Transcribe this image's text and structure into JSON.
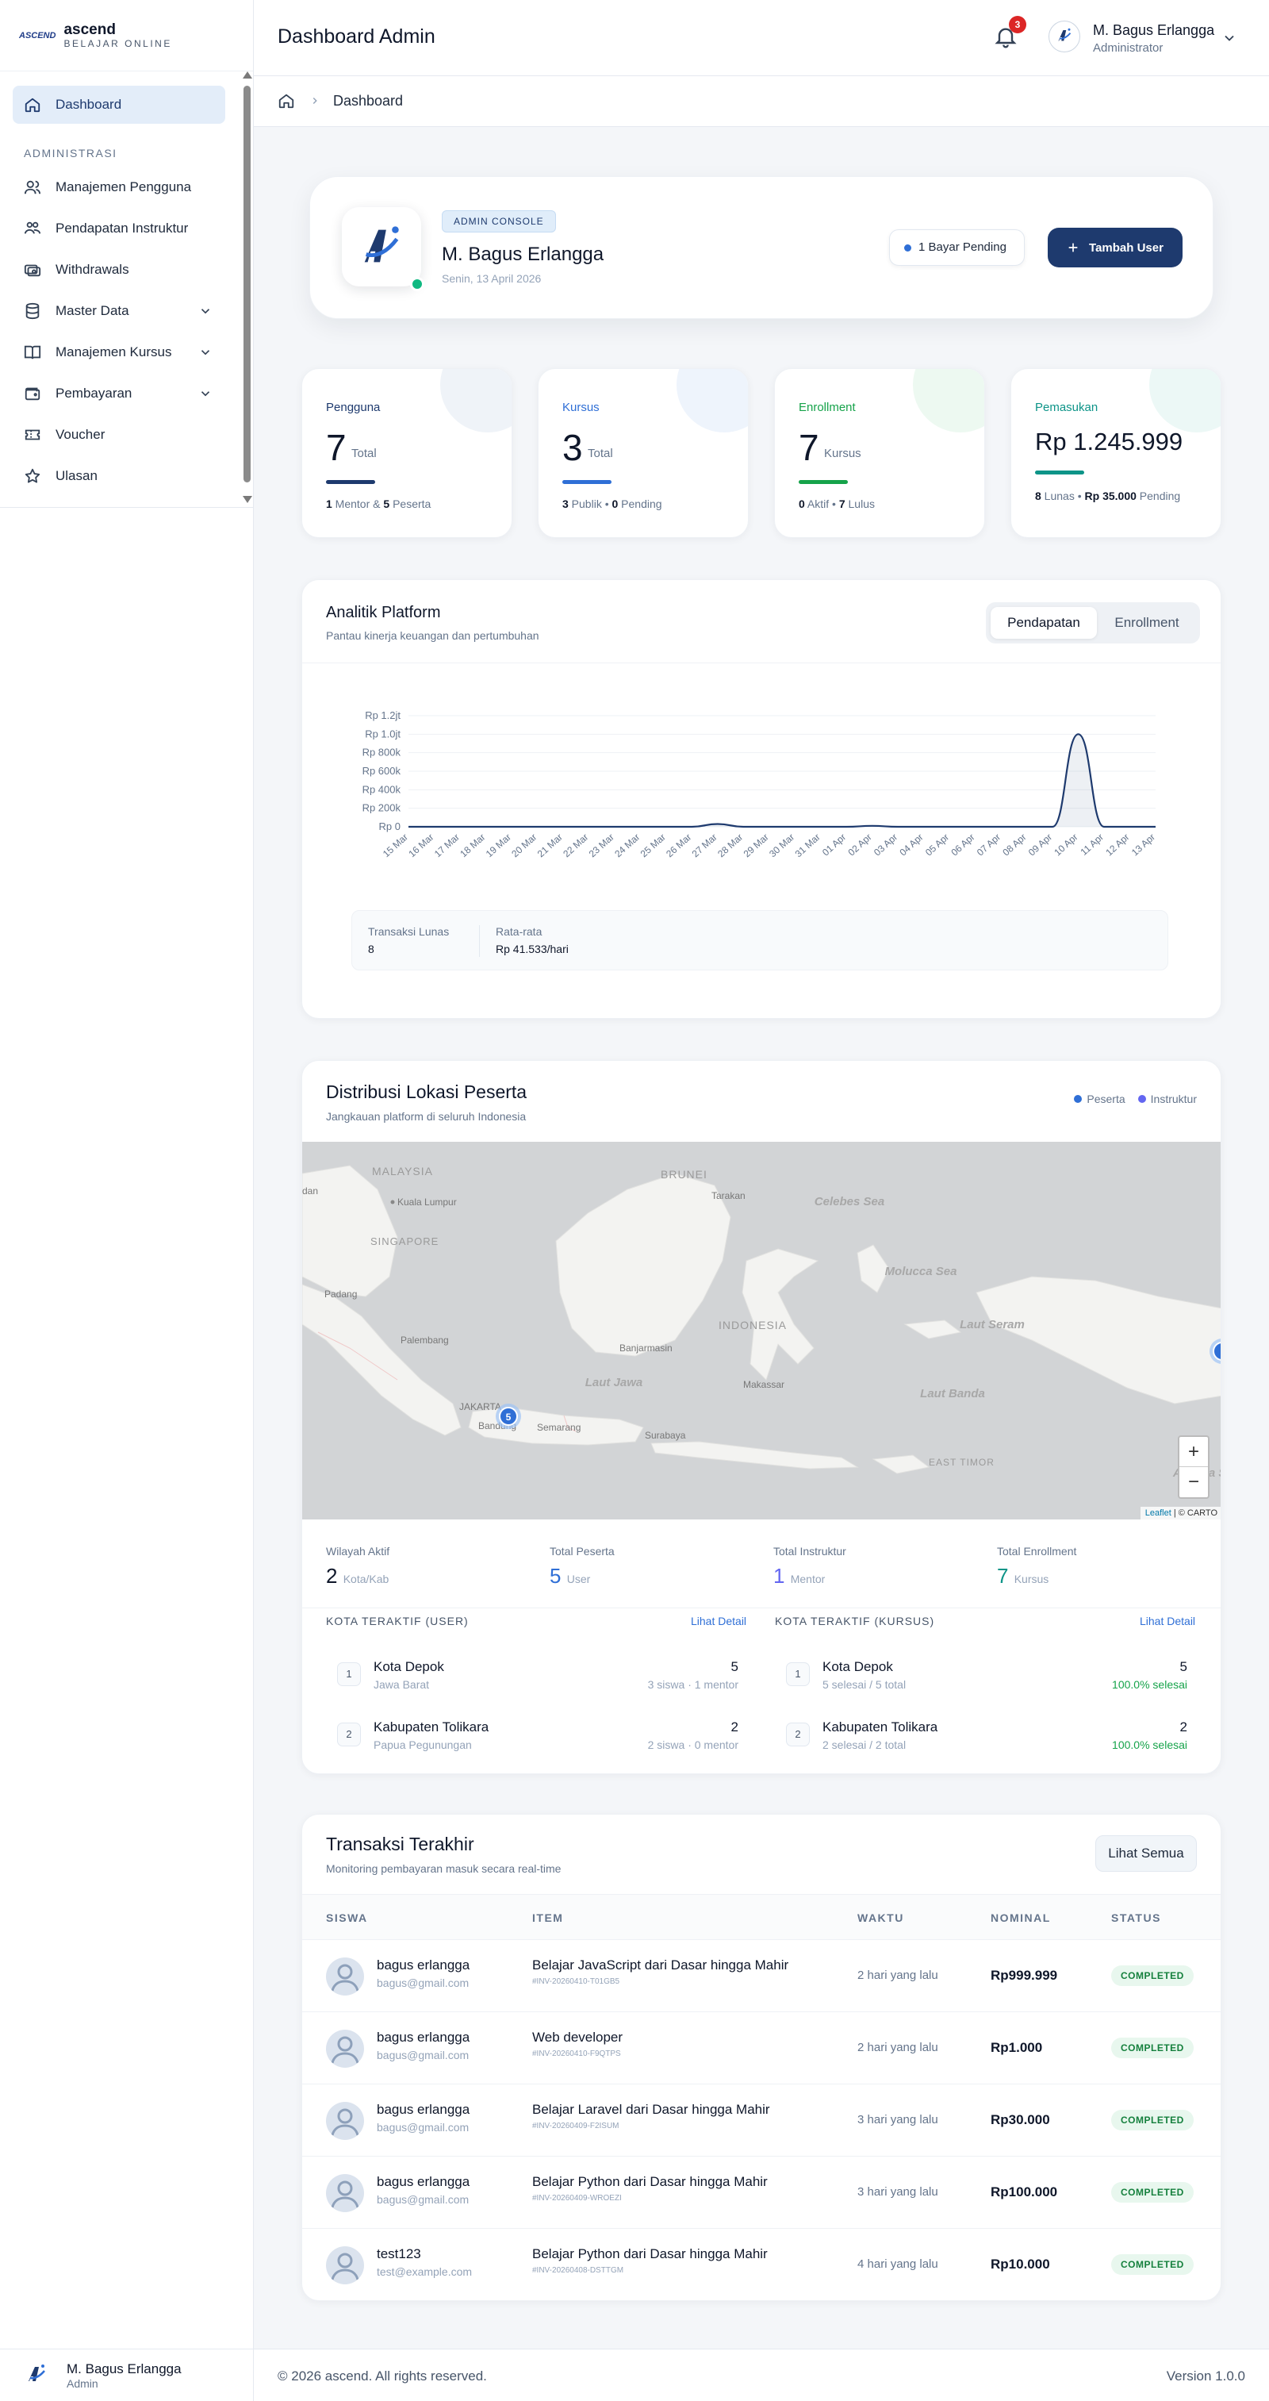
{
  "brand": {
    "badge": "ASCEND",
    "name": "ascend",
    "tagline": "BELAJAR ONLINE"
  },
  "sidebar": {
    "section_label": "ADMINISTRASI",
    "items": [
      {
        "label": "Dashboard",
        "icon": "home-icon",
        "active": true
      },
      {
        "label": "Manajemen Pengguna",
        "icon": "users-icon"
      },
      {
        "label": "Pendapatan Instruktur",
        "icon": "instructor-income-icon"
      },
      {
        "label": "Withdrawals",
        "icon": "withdraw-icon"
      },
      {
        "label": "Master Data",
        "icon": "database-icon",
        "expandable": true
      },
      {
        "label": "Manajemen Kursus",
        "icon": "book-icon",
        "expandable": true
      },
      {
        "label": "Pembayaran",
        "icon": "wallet-icon",
        "expandable": true
      },
      {
        "label": "Voucher",
        "icon": "ticket-icon"
      },
      {
        "label": "Ulasan",
        "icon": "star-icon"
      }
    ],
    "user": {
      "name": "M. Bagus Erlangga",
      "role": "Admin"
    }
  },
  "header": {
    "title": "Dashboard Admin",
    "notification_count": "3",
    "user_name": "M. Bagus Erlangga",
    "user_role": "Administrator"
  },
  "breadcrumb": {
    "current": "Dashboard"
  },
  "profile": {
    "badge": "ADMIN CONSOLE",
    "name": "M. Bagus Erlangga",
    "date": "Senin, 13 April 2026",
    "pending_label": "1 Bayar Pending",
    "add_user_label": "Tambah User"
  },
  "stats": [
    {
      "label": "Pengguna",
      "value": "7",
      "unit": "Total",
      "sub_a": "1",
      "sub_a_text": " Mentor & ",
      "sub_b": "5",
      "sub_b_text": " Peserta",
      "color": "#1e3a6e"
    },
    {
      "label": "Kursus",
      "value": "3",
      "unit": "Total",
      "sub_a": "3",
      "sub_a_text": " Publik • ",
      "sub_b": "0",
      "sub_b_text": " Pending",
      "color": "#2f6fd6"
    },
    {
      "label": "Enrollment",
      "value": "7",
      "unit": "Kursus",
      "sub_a": "0",
      "sub_a_text": " Aktif • ",
      "sub_b": "7",
      "sub_b_text": " Lulus",
      "color": "#16a34a"
    },
    {
      "label": "Pemasukan",
      "value": "Rp 1.245.999",
      "unit": "",
      "sub_a": "8",
      "sub_a_text": " Lunas • ",
      "sub_b": "Rp 35.000",
      "sub_b_text": " Pending",
      "color": "#0d9488"
    }
  ],
  "analytics": {
    "title": "Analitik Platform",
    "subtitle": "Pantau kinerja keuangan dan pertumbuhan",
    "tabs": [
      "Pendapatan",
      "Enrollment"
    ],
    "stat1_label": "Transaksi Lunas",
    "stat1_value": "8",
    "stat2_label": "Rata-rata",
    "stat2_value": "Rp 41.533/hari"
  },
  "chart_data": {
    "type": "area",
    "x": [
      "15 Mar",
      "16 Mar",
      "17 Mar",
      "18 Mar",
      "19 Mar",
      "20 Mar",
      "21 Mar",
      "22 Mar",
      "23 Mar",
      "24 Mar",
      "25 Mar",
      "26 Mar",
      "27 Mar",
      "28 Mar",
      "29 Mar",
      "30 Mar",
      "31 Mar",
      "01 Apr",
      "02 Apr",
      "03 Apr",
      "04 Apr",
      "05 Apr",
      "06 Apr",
      "07 Apr",
      "08 Apr",
      "09 Apr",
      "10 Apr",
      "11 Apr",
      "12 Apr",
      "13 Apr"
    ],
    "y_ticks": [
      "Rp 0",
      "Rp 200k",
      "Rp 400k",
      "Rp 600k",
      "Rp 800k",
      "Rp 1.0jt",
      "Rp 1.2jt"
    ],
    "ylim": [
      0,
      1200000
    ],
    "series": [
      {
        "values": [
          0,
          0,
          0,
          0,
          0,
          0,
          0,
          0,
          0,
          0,
          0,
          0,
          30000,
          0,
          0,
          0,
          0,
          0,
          10000,
          0,
          0,
          0,
          0,
          0,
          0,
          0,
          999999,
          0,
          0,
          0
        ]
      }
    ],
    "color": "#1e3a6e",
    "grid": true
  },
  "map": {
    "title": "Distribusi Lokasi Peserta",
    "subtitle": "Jangkauan platform di seluruh Indonesia",
    "legend": [
      {
        "label": "Peserta",
        "color": "#2f6fd6"
      },
      {
        "label": "Instruktur",
        "color": "#6366f1"
      }
    ],
    "places": [
      {
        "label": "MALAYSIA",
        "type": "country"
      },
      {
        "label": "BRUNEI",
        "type": "country"
      },
      {
        "label": "INDONESIA",
        "type": "country"
      },
      {
        "label": "EAST TIMOR",
        "type": "country"
      },
      {
        "label": "SINGAPORE",
        "type": "country"
      },
      {
        "label": "Celebes Sea",
        "type": "sea"
      },
      {
        "label": "Molucca Sea",
        "type": "sea"
      },
      {
        "label": "Laut Seram",
        "type": "sea"
      },
      {
        "label": "Laut Jawa",
        "type": "sea"
      },
      {
        "label": "Laut Banda",
        "type": "sea"
      },
      {
        "label": "Arafura Sea",
        "type": "sea"
      },
      {
        "label": "Kuala Lumpur",
        "type": "city"
      },
      {
        "label": "Tarakan",
        "type": "city"
      },
      {
        "label": "Padang",
        "type": "city"
      },
      {
        "label": "Palembang",
        "type": "city"
      },
      {
        "label": "Banjarmasin",
        "type": "city"
      },
      {
        "label": "Makassar",
        "type": "city"
      },
      {
        "label": "JAKARTA",
        "type": "city"
      },
      {
        "label": "Bandung",
        "type": "city"
      },
      {
        "label": "Semarang",
        "type": "city"
      },
      {
        "label": "Surabaya",
        "type": "city"
      },
      {
        "label": "dan",
        "type": "city"
      }
    ],
    "cluster_count": "5",
    "zoom_in": "+",
    "zoom_out": "−",
    "attribution_link": "Leaflet",
    "attribution_rest": " | © CARTO",
    "stats": [
      {
        "label": "Wilayah Aktif",
        "value": "2",
        "unit": "Kota/Kab",
        "color": "#0f172a"
      },
      {
        "label": "Total Peserta",
        "value": "5",
        "unit": "User",
        "color": "#2f6fd6"
      },
      {
        "label": "Total Instruktur",
        "value": "1",
        "unit": "Mentor",
        "color": "#6366f1"
      },
      {
        "label": "Total Enrollment",
        "value": "7",
        "unit": "Kursus",
        "color": "#0d9488"
      }
    ],
    "user_heading": "KOTA TERAKTIF (USER)",
    "course_heading": "KOTA TERAKTIF (KURSUS)",
    "detail_link": "Lihat Detail",
    "user_cities": [
      {
        "rank": "1",
        "name": "Kota Depok",
        "province": "Jawa Barat",
        "count": "5",
        "detail": "3 siswa · 1 mentor"
      },
      {
        "rank": "2",
        "name": "Kabupaten Tolikara",
        "province": "Papua Pegunungan",
        "count": "2",
        "detail": "2 siswa · 0 mentor"
      }
    ],
    "course_cities": [
      {
        "rank": "1",
        "name": "Kota Depok",
        "detail_a": "5 selesai / 5 total",
        "count": "5",
        "detail_b": "100.0% selesai"
      },
      {
        "rank": "2",
        "name": "Kabupaten Tolikara",
        "detail_a": "2 selesai / 2 total",
        "count": "2",
        "detail_b": "100.0% selesai"
      }
    ]
  },
  "transactions": {
    "title": "Transaksi Terakhir",
    "subtitle": "Monitoring pembayaran masuk secara real-time",
    "view_all": "Lihat Semua",
    "columns": [
      "SISWA",
      "ITEM",
      "WAKTU",
      "NOMINAL",
      "STATUS"
    ],
    "rows": [
      {
        "name": "bagus erlangga",
        "email": "bagus@gmail.com",
        "item": "Belajar JavaScript dari Dasar hingga Mahir",
        "invoice": "#INV-20260410-T01GB5",
        "time": "2 hari yang lalu",
        "amount": "Rp999.999",
        "status": "COMPLETED"
      },
      {
        "name": "bagus erlangga",
        "email": "bagus@gmail.com",
        "item": "Web developer",
        "invoice": "#INV-20260410-F9QTPS",
        "time": "2 hari yang lalu",
        "amount": "Rp1.000",
        "status": "COMPLETED"
      },
      {
        "name": "bagus erlangga",
        "email": "bagus@gmail.com",
        "item": "Belajar Laravel dari Dasar hingga Mahir",
        "invoice": "#INV-20260409-F2ISUM",
        "time": "3 hari yang lalu",
        "amount": "Rp30.000",
        "status": "COMPLETED"
      },
      {
        "name": "bagus erlangga",
        "email": "bagus@gmail.com",
        "item": "Belajar Python dari Dasar hingga Mahir",
        "invoice": "#INV-20260409-WROEZI",
        "time": "3 hari yang lalu",
        "amount": "Rp100.000",
        "status": "COMPLETED"
      },
      {
        "name": "test123",
        "email": "test@example.com",
        "item": "Belajar Python dari Dasar hingga Mahir",
        "invoice": "#INV-20260408-DSTTGM",
        "time": "4 hari yang lalu",
        "amount": "Rp10.000",
        "status": "COMPLETED"
      }
    ]
  },
  "footer": {
    "copyright": "© 2026 ascend. All rights reserved.",
    "version": "Version 1.0.0"
  }
}
